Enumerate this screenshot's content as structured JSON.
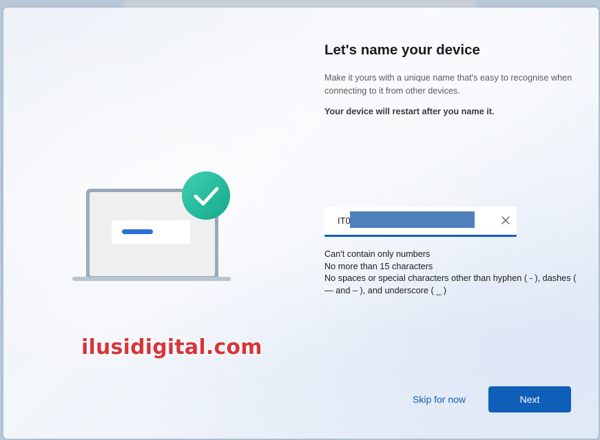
{
  "page": {
    "heading": "Let's name your device",
    "description": "Make it yours with a unique name that's easy to recognise when connecting to it from other devices.",
    "restart_warning": "Your device will restart after you name it."
  },
  "device_name": {
    "value": "IT0",
    "value_redacted": true,
    "clear_icon": "close-icon"
  },
  "rules": [
    "Can't contain only numbers",
    "No more than 15 characters",
    "No spaces or special characters other than hyphen ( - ), dashes ( — and – ), and underscore ( _ )"
  ],
  "illustration": {
    "icon": "laptop-with-checkmark-icon",
    "accent_color": "#1fb59a",
    "bar_color": "#2f6fd6"
  },
  "watermark": "ilusidigital.com",
  "footer": {
    "skip_label": "Skip for now",
    "next_label": "Next"
  },
  "colors": {
    "accent": "#0f5fb8",
    "watermark": "#d6353a"
  }
}
